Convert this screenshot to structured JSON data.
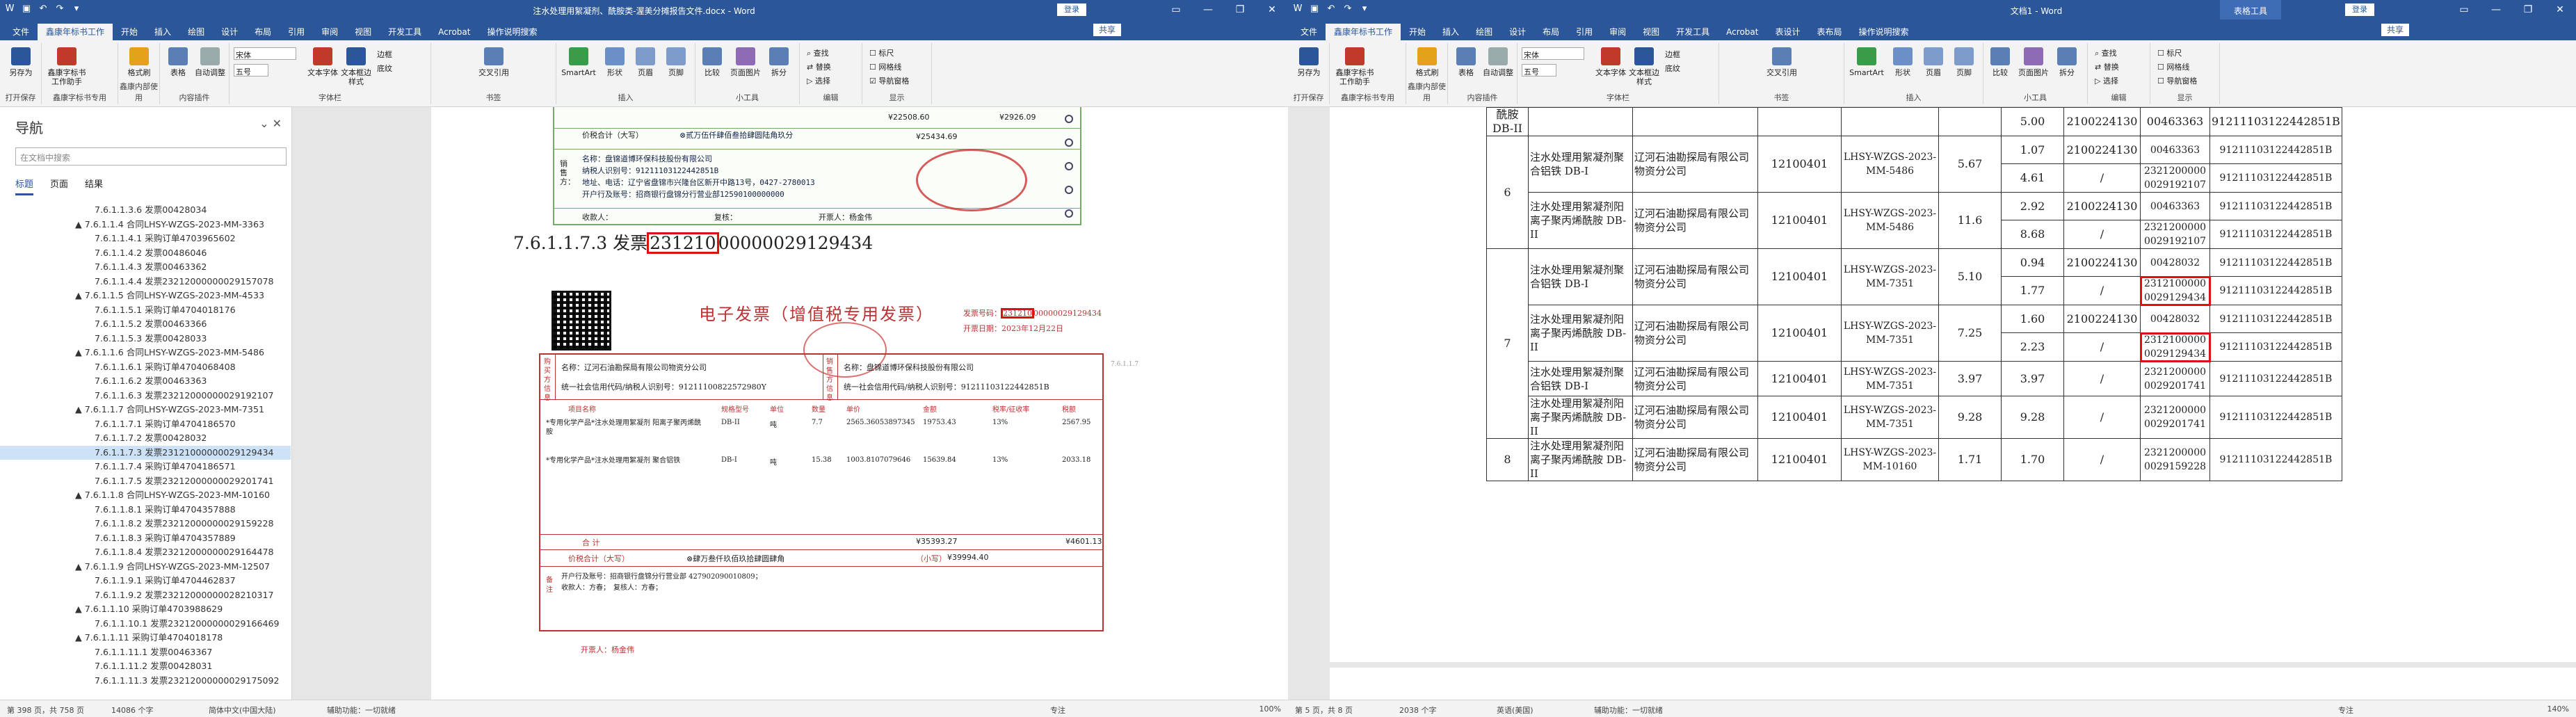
{
  "left": {
    "title": "注水处理用絮凝剂、酰胺类-渥美分摊报告文件.docx - Word",
    "login": "登录",
    "share": "共享",
    "tabs": [
      "文件",
      "鑫康年标书工作",
      "开始",
      "插入",
      "绘图",
      "设计",
      "布局",
      "引用",
      "审阅",
      "视图",
      "开发工具",
      "Acrobat",
      "操作说明搜索"
    ],
    "ribbon": {
      "groups": [
        "打开保存",
        "鑫康字标书专用",
        "鑫康内部使用",
        "内容插件",
        "字体栏",
        "书签",
        "插入",
        "小工具",
        "编辑",
        "显示"
      ],
      "buttons": [
        "另存为",
        "鑫康字标书工作助手",
        "格式刷",
        "表格",
        "自动调整",
        "文本字体",
        "文本框边样式",
        "边框",
        "底纹",
        "交叉引用",
        "SmartArt",
        "形状",
        "页眉",
        "页脚",
        "比较",
        "页面图片",
        "拆分",
        "查找",
        "替换",
        "选择",
        "标尺",
        "网格线",
        "导航窗格"
      ],
      "font_name": "宋体",
      "font_size": "五号"
    },
    "nav": {
      "title": "导航",
      "search_placeholder": "在文档中搜索",
      "tabs": [
        "标题",
        "页面",
        "结果"
      ],
      "items": [
        "7.6.1.1.3.6 发票00428034",
        "▲ 7.6.1.1.4 合同LHSY-WZGS-2023-MM-3363",
        "7.6.1.1.4.1 采购订单4703965602",
        "7.6.1.1.4.2 发票00486046",
        "7.6.1.1.4.3 发票00463362",
        "7.6.1.1.4.4 发票23212000000029157078",
        "▲ 7.6.1.1.5 合同LHSY-WZGS-2023-MM-4533",
        "7.6.1.1.5.1 采购订单4704018176",
        "7.6.1.1.5.2 发票00463366",
        "7.6.1.1.5.3 发票00428033",
        "▲ 7.6.1.1.6 合同LHSY-WZGS-2023-MM-5486",
        "7.6.1.1.6.1 采购订单4704068408",
        "7.6.1.1.6.2 发票00463363",
        "7.6.1.1.6.3 发票23212000000029192107",
        "▲ 7.6.1.1.7 合同LHSY-WZGS-2023-MM-7351",
        "7.6.1.1.7.1 采购订单4704186570",
        "7.6.1.1.7.2 发票00428032",
        "7.6.1.1.7.3 发票23121000000029129434",
        "7.6.1.1.7.4 采购订单4704186571",
        "7.6.1.1.7.5 发票23212000000029201741",
        "▲ 7.6.1.1.8 合同LHSY-WZGS-2023-MM-10160",
        "7.6.1.1.8.1 采购订单4704357888",
        "7.6.1.1.8.2 发票23212000000029159228",
        "7.6.1.1.8.3 采购订单4704357889",
        "7.6.1.1.8.4 发票23212000000029164478",
        "▲ 7.6.1.1.9 合同LHSY-WZGS-2023-MM-12507",
        "7.6.1.1.9.1 采购订单4704462837",
        "7.6.1.1.9.2 发票23212000000028210317",
        "▲ 7.6.1.1.10 采购订单4703988629",
        "7.6.1.1.10.1 发票23212000000029166469",
        "▲ 7.6.1.1.11 采购订单4704018178",
        "7.6.1.1.11.1 发票00463367",
        "7.6.1.1.11.2 发票00428031",
        "7.6.1.1.11.3 发票23212000000029175092"
      ],
      "selected_index": 17
    },
    "doc": {
      "heading": "7.6.1.1.7.3 发票23121000000029129434",
      "heading_prefix": "7.6.1.1.7.3 发票",
      "heading_boxed": "231210",
      "heading_rest": "00000029129434",
      "upper_invoice": {
        "total_label": "价税合计（大写）",
        "total_cn": "⊗贰万伍仟肆佰叁拾肆圆陆角玖分",
        "amount1": "¥22508.60",
        "tax1": "¥2926.09",
        "total_small": "¥25434.69",
        "seller_name": "名称：盘锦道博环保科技股份有限公司",
        "seller_tax": "纳税人识别号：91211103122442851B",
        "seller_addr": "地址、电话：辽宁省盘锦市兴隆台区新开中路13号，0427-2780013",
        "seller_bank": "开户行及账号：招商银行盘锦分行营业部12590100000000",
        "payee": "收款人：",
        "reviewer": "复核：",
        "drawer": "开票人：杨金伟",
        "seller_label": "销售方："
      },
      "einvoice": {
        "title": "电子发票（增值税专用发票）",
        "no_label": "发票号码：",
        "no_boxed": "231210",
        "no_rest": "00000029129434",
        "date": "开票日期：2023年12月22日",
        "buyer_label": "购买方信息",
        "seller_label": "销售方信息",
        "buyer_name": "名称：辽河石油勘探局有限公司物资分公司",
        "buyer_tax": "统一社会信用代码/纳税人识别号：91211100822572980Y",
        "seller_name": "名称：盘锦道博环保科技股份有限公司",
        "seller_tax": "统一社会信用代码/纳税人识别号：91211103122442851B",
        "headers": [
          "项目名称",
          "规格型号",
          "单位",
          "数量",
          "单价",
          "金额",
          "税率/征收率",
          "税额"
        ],
        "rows": [
          [
            "*专用化学产品*注水处理用絮凝剂 阳离子聚丙烯酰胺",
            "DB-II",
            "吨",
            "7.7",
            "2565.36053897345",
            "19753.43",
            "13%",
            "2567.95"
          ],
          [
            "*专用化学产品*注水处理用絮凝剂 聚合铝铁",
            "DB-I",
            "吨",
            "15.38",
            "1003.8107079646",
            "15639.84",
            "13%",
            "2033.18"
          ]
        ],
        "sum_label": "合 计",
        "sum_amount": "¥35393.27",
        "sum_tax": "¥4601.13",
        "total_label": "价税合计（大写）",
        "total_cn": "⊗肆万叁仟玖佰玖拾肆圆肆角",
        "total_small_label": "（小写）",
        "total_small": "¥39994.40",
        "remark_label": "备注",
        "remark": "开户行及账号：招商银行盘锦分行营业部 427902090010809；",
        "remark2": "收款人：方春；　复核人：方春；",
        "drawer": "开票人：杨金伟",
        "side_code": "7.6.1.1.7"
      }
    },
    "status": [
      "第 398 页，共 758 页",
      "14086 个字",
      "简体中文(中国大陆)",
      "辅助功能：一切就绪",
      "专注",
      "100%"
    ]
  },
  "right": {
    "title": "文档1 - Word",
    "table_tools": "表格工具",
    "login": "登录",
    "share": "共享",
    "tabs": [
      "文件",
      "鑫康年标书工作",
      "开始",
      "插入",
      "绘图",
      "设计",
      "布局",
      "引用",
      "审阅",
      "视图",
      "开发工具",
      "Acrobat",
      "表设计",
      "表布局",
      "操作说明搜索"
    ],
    "table": {
      "rows": [
        [
          "",
          "",
          "",
          "",
          "",
          "",
          "",
          ""
        ],
        [
          "6",
          "注水处理用絮凝剂聚合铝铁 DB-I",
          "辽河石油勘探局有限公司物资分公司",
          "12100401",
          "LHSY-WZGS-2023-MM-5486",
          "5.67",
          "1.07",
          "2100224130",
          "00463363",
          "91211103122442851B"
        ],
        [
          "",
          "",
          "",
          "",
          "",
          "",
          "4.61",
          "/",
          "23212000000029192107",
          "91211103122442851B"
        ],
        [
          "",
          "注水处理用絮凝剂阳离子聚丙烯酰胺 DB-II",
          "辽河石油勘探局有限公司物资分公司",
          "12100401",
          "LHSY-WZGS-2023-MM-5486",
          "11.6",
          "2.92",
          "2100224130",
          "00463363",
          "91211103122442851B"
        ],
        [
          "",
          "",
          "",
          "",
          "",
          "",
          "8.68",
          "/",
          "23212000000029192107",
          "91211103122442851B"
        ],
        [
          "7",
          "注水处理用絮凝剂聚合铝铁 DB-I",
          "辽河石油勘探局有限公司物资分公司",
          "12100401",
          "LHSY-WZGS-2023-MM-7351",
          "5.10",
          "0.94",
          "2100224130",
          "00428032",
          "91211103122442851B"
        ],
        [
          "",
          "",
          "",
          "",
          "",
          "",
          "1.77",
          "/",
          "23121000000029129434",
          "91211103122442851B"
        ],
        [
          "",
          "注水处理用絮凝剂阳离子聚丙烯酰胺 DB-II",
          "辽河石油勘探局有限公司物资分公司",
          "12100401",
          "LHSY-WZGS-2023-MM-7351",
          "7.25",
          "1.60",
          "2100224130",
          "00428032",
          "91211103122442851B"
        ],
        [
          "",
          "",
          "",
          "",
          "",
          "",
          "2.23",
          "/",
          "23121000000029129434",
          "91211103122442851B"
        ],
        [
          "",
          "注水处理用絮凝剂聚合铝铁 DB-I",
          "辽河石油勘探局有限公司物资分公司",
          "12100401",
          "LHSY-WZGS-2023-MM-7351",
          "3.97",
          "3.97",
          "/",
          "23212000000029201741",
          "91211103122442851B"
        ],
        [
          "",
          "注水处理用絮凝剂阳离子聚丙烯酰胺 DB-II",
          "辽河石油勘探局有限公司物资分公司",
          "12100401",
          "LHSY-WZGS-2023-MM-7351",
          "9.28",
          "9.28",
          "/",
          "23212000000029201741",
          "91211103122442851B"
        ],
        [
          "8",
          "注水处理用絮凝剂阳离子聚丙烯酰胺 DB-II",
          "辽河石油勘探局有限公司物资分公司",
          "12100401",
          "LHSY-WZGS-2023-MM-10160",
          "1.71",
          "1.70",
          "/",
          "23212000000029159228",
          "91211103122442851B"
        ]
      ],
      "top_partial": [
        "酰胺 DB-II",
        "",
        "",
        "",
        "",
        "",
        "5.00",
        "2100224130",
        "00463363",
        "91211103122442851B"
      ]
    },
    "status": [
      "第 5 页，共 8 页",
      "2038 个字",
      "英语(美国)",
      "辅助功能：一切就绪",
      "专注",
      "140%"
    ]
  }
}
